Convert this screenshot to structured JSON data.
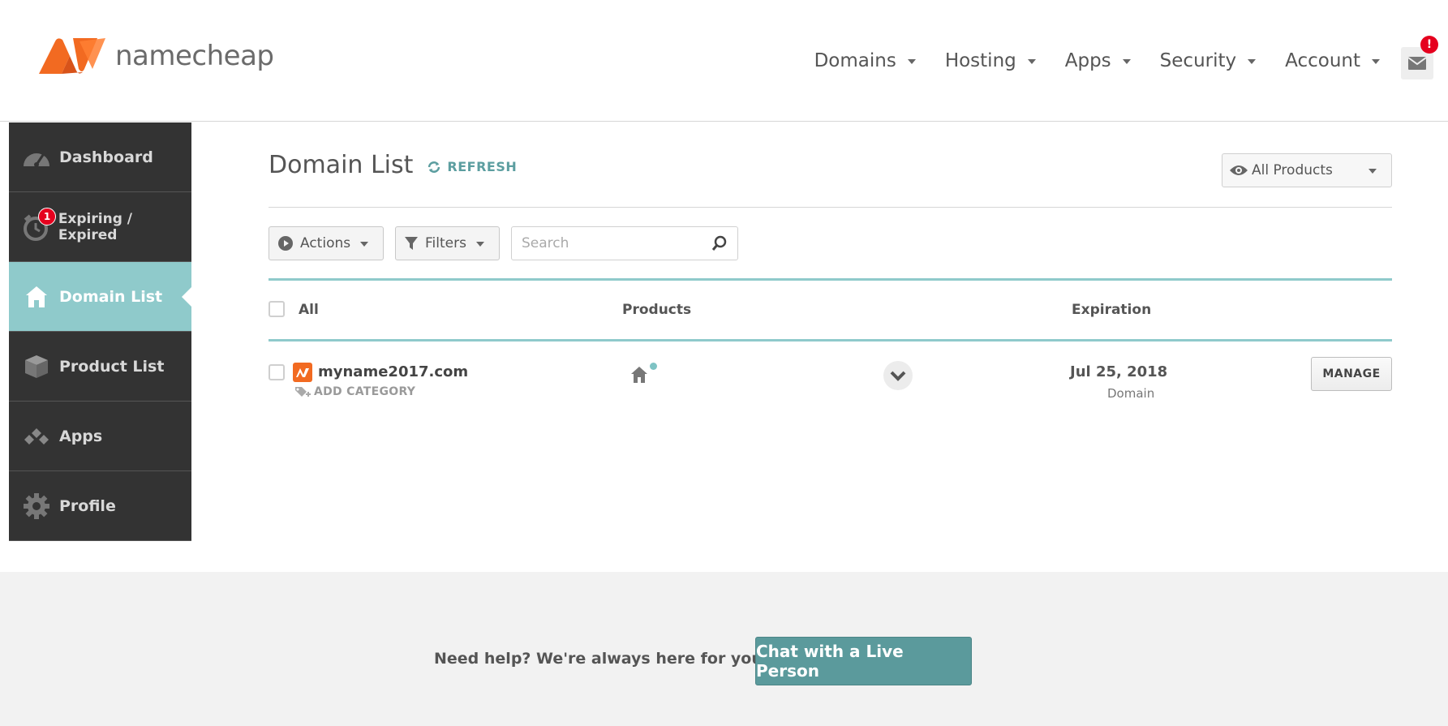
{
  "header": {
    "logo_text": "namecheap",
    "nav": [
      {
        "label": "Domains"
      },
      {
        "label": "Hosting"
      },
      {
        "label": "Apps"
      },
      {
        "label": "Security"
      },
      {
        "label": "Account"
      }
    ],
    "mail_badge": "!"
  },
  "sidebar": {
    "items": [
      {
        "label": "Dashboard",
        "icon": "speedometer-icon"
      },
      {
        "label": "Expiring / Expired",
        "icon": "alarm-clock-icon",
        "badge": "1"
      },
      {
        "label": "Domain List",
        "icon": "home-icon",
        "active": true
      },
      {
        "label": "Product List",
        "icon": "box-icon"
      },
      {
        "label": "Apps",
        "icon": "apps-icon"
      },
      {
        "label": "Profile",
        "icon": "gear-icon"
      }
    ]
  },
  "main": {
    "title": "Domain List",
    "refresh_label": "REFRESH",
    "product_filter": "All Products",
    "toolbar": {
      "actions_label": "Actions",
      "filters_label": "Filters",
      "search_placeholder": "Search"
    },
    "table": {
      "headers": {
        "select_all": "All",
        "products": "Products",
        "expiration": "Expiration"
      },
      "rows": [
        {
          "domain": "myname2017.com",
          "add_category": "ADD CATEGORY",
          "expiration_date": "Jul 25, 2018",
          "expiration_type": "Domain",
          "manage_label": "MANAGE"
        }
      ]
    }
  },
  "footer": {
    "help_text": "Need help? We're always here for you.",
    "chat_label": "Chat with a Live Person"
  },
  "colors": {
    "brand_orange": "#f26a21",
    "accent_teal": "#8fcacb",
    "chat_button": "#5b9a9c",
    "sidebar_bg": "#333333",
    "badge_red": "#e5001e"
  }
}
